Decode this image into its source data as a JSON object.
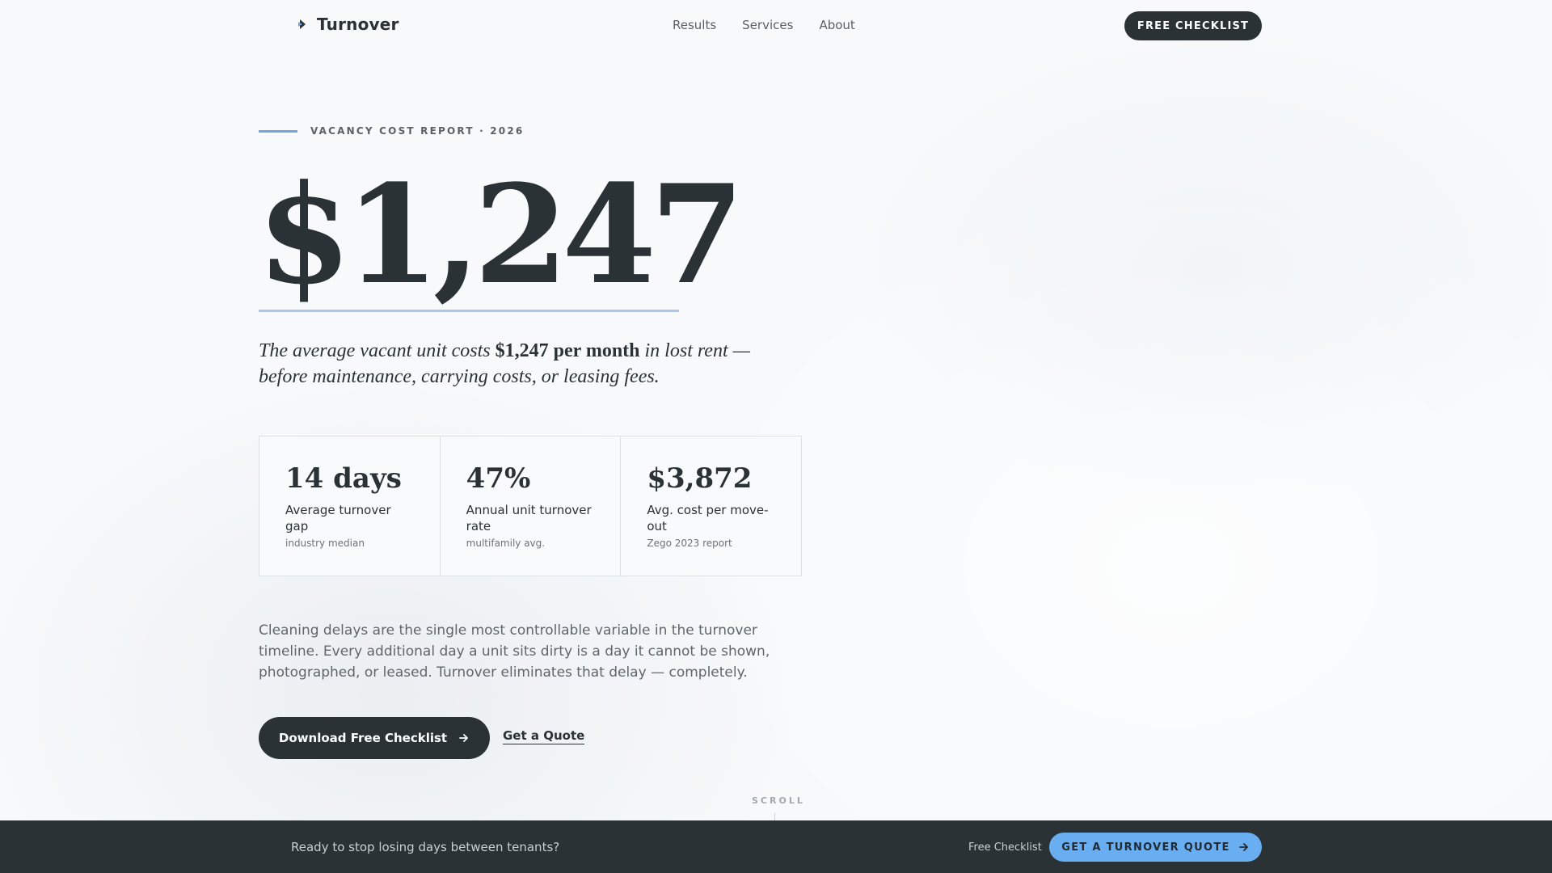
{
  "brand": {
    "name": "Turnover",
    "icon": "logo-mark-icon",
    "accent": "#6fa6dd"
  },
  "nav": {
    "items": [
      "Results",
      "Services",
      "About"
    ]
  },
  "header": {
    "cta_label": "FREE CHECKLIST"
  },
  "hero": {
    "eyebrow": "VACANCY COST REPORT · 2026",
    "big_number": "$1,247",
    "lede_part1": "The average vacant unit costs ",
    "lede_bold": "$1,247 per month",
    "lede_part2": " in lost rent — before maintenance, carrying costs, or leasing fees."
  },
  "stats": [
    {
      "value": "14 days",
      "label": "Average turnover gap",
      "source": "industry median"
    },
    {
      "value": "47%",
      "label": "Annual unit turnover rate",
      "source": "multifamily avg."
    },
    {
      "value": "$3,872",
      "label": "Avg. cost per move-out",
      "source": "Zego 2023 report"
    }
  ],
  "body_copy": "Cleaning delays are the single most controllable variable in the turnover timeline. Every additional day a unit sits dirty is a day it cannot be shown, photographed, or leased. Turnover eliminates that delay — completely.",
  "actions": {
    "primary_label": "Download Free Checklist",
    "secondary_label": "Get a Quote",
    "arrow_icon": "arrow-right-icon"
  },
  "scroll_hint": "SCROLL",
  "bottom_bar": {
    "text": "Ready to stop losing days between tenants?",
    "link_label": "Free Checklist",
    "cta_label": "GET A TURNOVER QUOTE",
    "cta_color": "#6aaef2"
  },
  "colors": {
    "ink": "#2b3235",
    "background": "#f7f9fb",
    "accent_blue": "#6fa6dd"
  }
}
